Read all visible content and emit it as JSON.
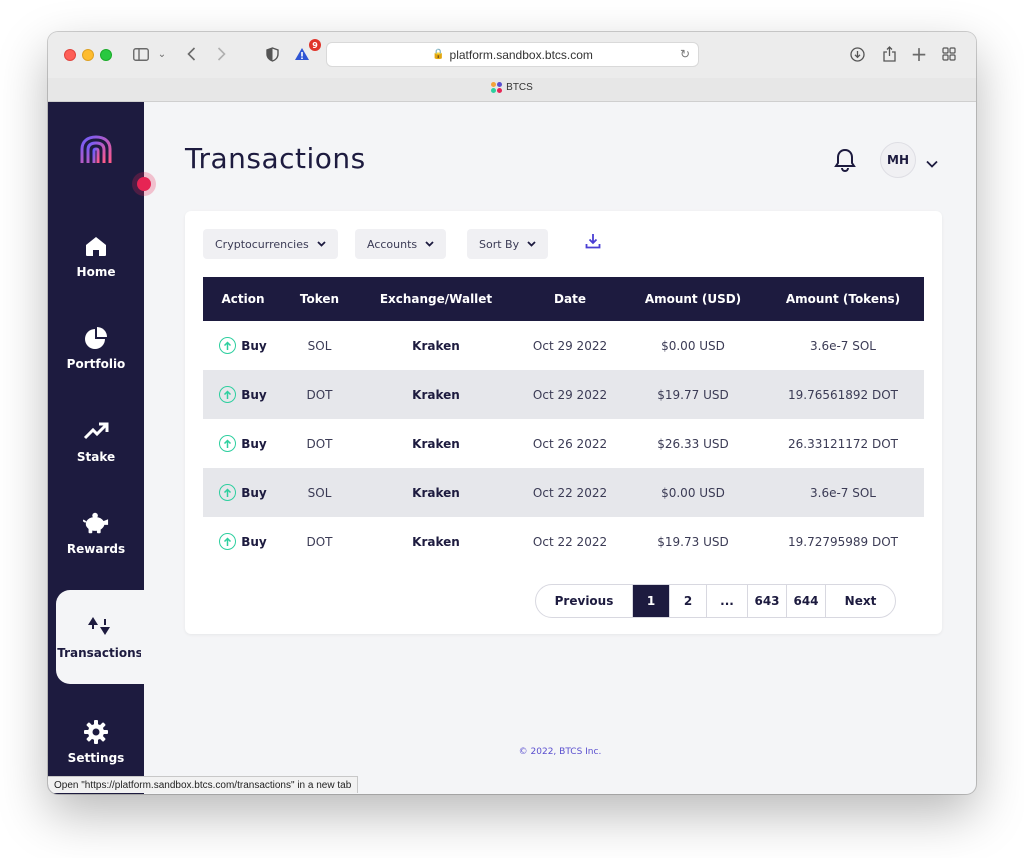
{
  "browser": {
    "url": "platform.sandbox.btcs.com",
    "tab_title": "BTCS",
    "extension_badge": "9",
    "status_link": "Open \"https://platform.sandbox.btcs.com/transactions\" in a new tab"
  },
  "sidebar": {
    "items": [
      {
        "label": "Home",
        "icon": "home-icon"
      },
      {
        "label": "Portfolio",
        "icon": "pie-chart-icon"
      },
      {
        "label": "Stake",
        "icon": "trend-up-icon"
      },
      {
        "label": "Rewards",
        "icon": "piggy-bank-icon"
      },
      {
        "label": "Transactions",
        "icon": "transactions-icon",
        "active": true
      },
      {
        "label": "Settings",
        "icon": "gear-icon"
      }
    ]
  },
  "header": {
    "title": "Transactions",
    "avatar_initials": "MH"
  },
  "filters": {
    "cryptocurrencies": "Cryptocurrencies",
    "accounts": "Accounts",
    "sort_by": "Sort By"
  },
  "table": {
    "columns": [
      "Action",
      "Token",
      "Exchange/Wallet",
      "Date",
      "Amount (USD)",
      "Amount (Tokens)"
    ],
    "rows": [
      {
        "action": "Buy",
        "token": "SOL",
        "exchange": "Kraken",
        "date": "Oct 29 2022",
        "usd": "$0.00 USD",
        "tokens": "3.6e-7 SOL"
      },
      {
        "action": "Buy",
        "token": "DOT",
        "exchange": "Kraken",
        "date": "Oct 29 2022",
        "usd": "$19.77 USD",
        "tokens": "19.76561892 DOT"
      },
      {
        "action": "Buy",
        "token": "DOT",
        "exchange": "Kraken",
        "date": "Oct 26 2022",
        "usd": "$26.33 USD",
        "tokens": "26.33121172 DOT"
      },
      {
        "action": "Buy",
        "token": "SOL",
        "exchange": "Kraken",
        "date": "Oct 22 2022",
        "usd": "$0.00 USD",
        "tokens": "3.6e-7 SOL"
      },
      {
        "action": "Buy",
        "token": "DOT",
        "exchange": "Kraken",
        "date": "Oct 22 2022",
        "usd": "$19.73 USD",
        "tokens": "19.72795989 DOT"
      }
    ]
  },
  "pagination": {
    "previous": "Previous",
    "pages": [
      "1",
      "2",
      "...",
      "643",
      "644"
    ],
    "current": "1",
    "next": "Next"
  },
  "footer": "© 2022, BTCS Inc.",
  "colors": {
    "sidebar": "#1d1b3f",
    "accent_buy": "#2ecf9f",
    "notification": "#e62454"
  }
}
